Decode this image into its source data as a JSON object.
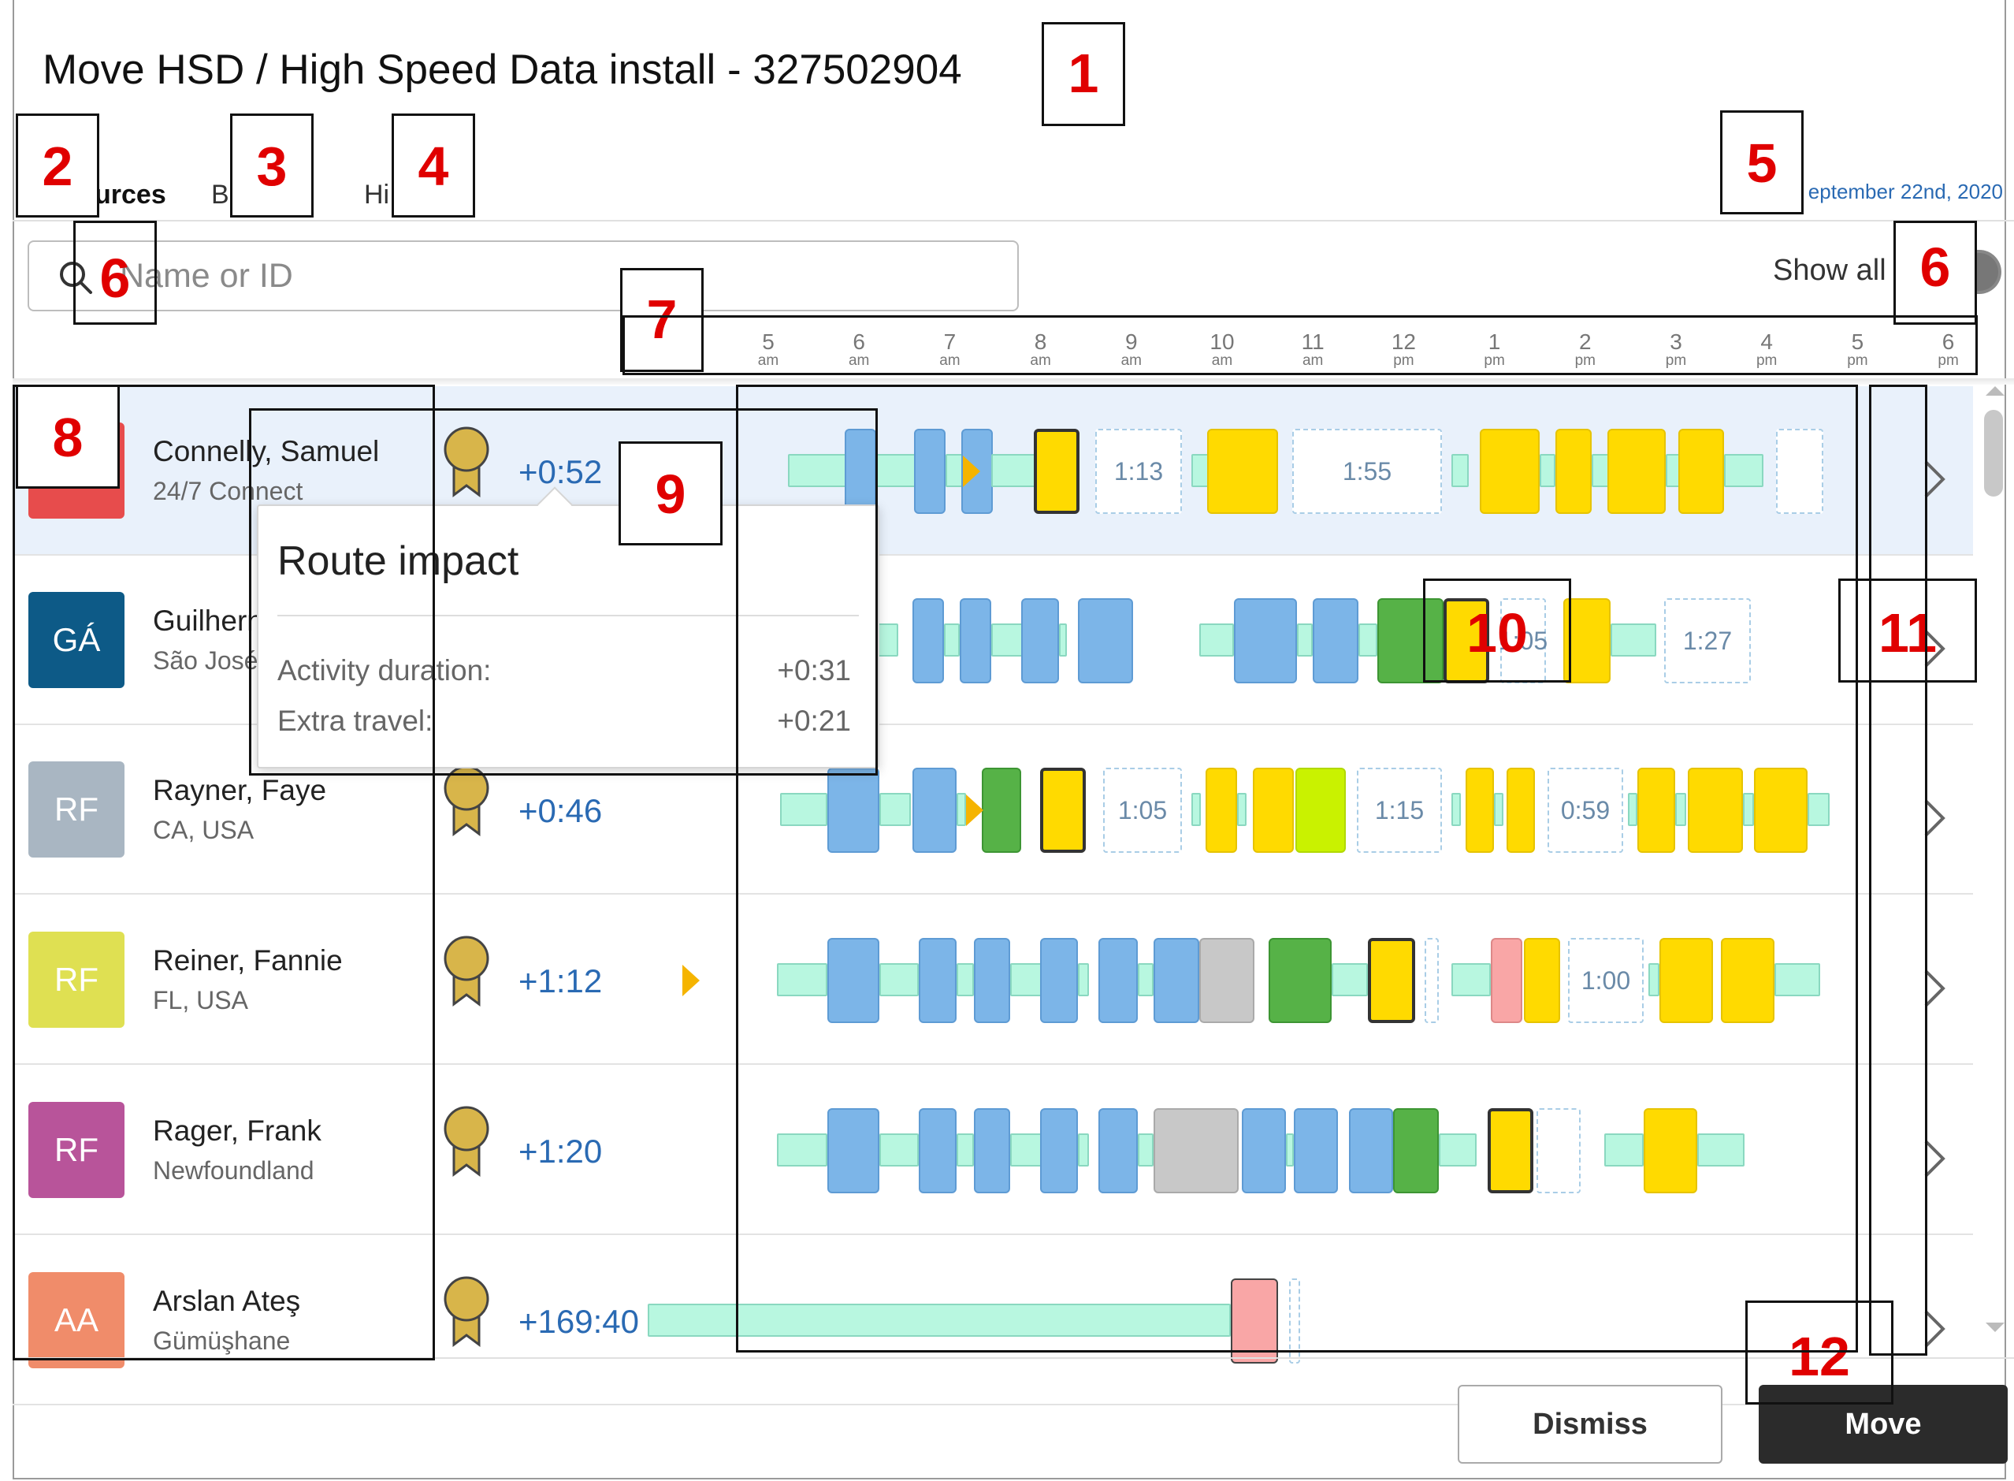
{
  "dialog": {
    "title": "Move HSD / High Speed Data install - 327502904"
  },
  "tabs": [
    {
      "label": "Resources",
      "visible_text": "urces"
    },
    {
      "label": "B"
    },
    {
      "label": "Hi"
    }
  ],
  "date_text": "eptember 22nd, 2020",
  "search": {
    "placeholder": "Name or ID"
  },
  "show_all": {
    "label": "Show all",
    "state": "on"
  },
  "time_axis": [
    {
      "hour": "5",
      "ampm": "am"
    },
    {
      "hour": "6",
      "ampm": "am"
    },
    {
      "hour": "7",
      "ampm": "am"
    },
    {
      "hour": "8",
      "ampm": "am"
    },
    {
      "hour": "9",
      "ampm": "am"
    },
    {
      "hour": "10",
      "ampm": "am"
    },
    {
      "hour": "11",
      "ampm": "am"
    },
    {
      "hour": "12",
      "ampm": "pm"
    },
    {
      "hour": "1",
      "ampm": "pm"
    },
    {
      "hour": "2",
      "ampm": "pm"
    },
    {
      "hour": "3",
      "ampm": "pm"
    },
    {
      "hour": "4",
      "ampm": "pm"
    },
    {
      "hour": "5",
      "ampm": "pm"
    },
    {
      "hour": "6",
      "ampm": "pm"
    }
  ],
  "resources": [
    {
      "name": "Connelly, Samuel",
      "location": "24/7 Connect",
      "initials": "",
      "avatar_color": "#e74c4c",
      "impact": "+0:52",
      "selected": true
    },
    {
      "name": "Guilhern",
      "location": "São José",
      "initials": "GÁ",
      "avatar_color": "#0d5a87",
      "impact": "",
      "selected": false
    },
    {
      "name": "Rayner, Faye",
      "location": "CA, USA",
      "initials": "RF",
      "avatar_color": "#a9b6c2",
      "impact": "+0:46",
      "selected": false
    },
    {
      "name": "Reiner, Fannie",
      "location": "FL, USA",
      "initials": "RF",
      "avatar_color": "#dfe052",
      "impact": "+1:12",
      "selected": false
    },
    {
      "name": "Rager, Frank",
      "location": "Newfoundland",
      "initials": "RF",
      "avatar_color": "#b8549a",
      "impact": "+1:20",
      "selected": false
    },
    {
      "name": "Arslan Ateş",
      "location": "Gümüşhane",
      "initials": "AA",
      "avatar_color": "#f08c6a",
      "impact": "+169:40",
      "selected": false
    }
  ],
  "gap_labels": {
    "r0": [
      "1:13",
      "1:55"
    ],
    "r1": [
      "1:05",
      "1:27"
    ],
    "r2": [
      "1:05",
      "1:15",
      "0:59"
    ],
    "r3": [
      "1:00"
    ]
  },
  "route_impact": {
    "title": "Route impact",
    "rows": [
      {
        "label": "Activity duration:",
        "value": "+0:31"
      },
      {
        "label": "Extra travel:",
        "value": "+0:21"
      }
    ]
  },
  "buttons": {
    "dismiss": "Dismiss",
    "move": "Move"
  },
  "annotations": [
    "1",
    "2",
    "3",
    "4",
    "5",
    "6",
    "6",
    "7",
    "8",
    "9",
    "10",
    "11",
    "12"
  ],
  "colors": {
    "accent": "#2a6ab3",
    "work_blue": "#7cb5e8",
    "work_yellow": "#ffda00",
    "work_green": "#56b247",
    "work_lime": "#c9f200",
    "work_grey": "#c8c8c8",
    "work_pink": "#f9a6a6",
    "travel": "#b8f7e0",
    "annotation_red": "#e00000"
  }
}
